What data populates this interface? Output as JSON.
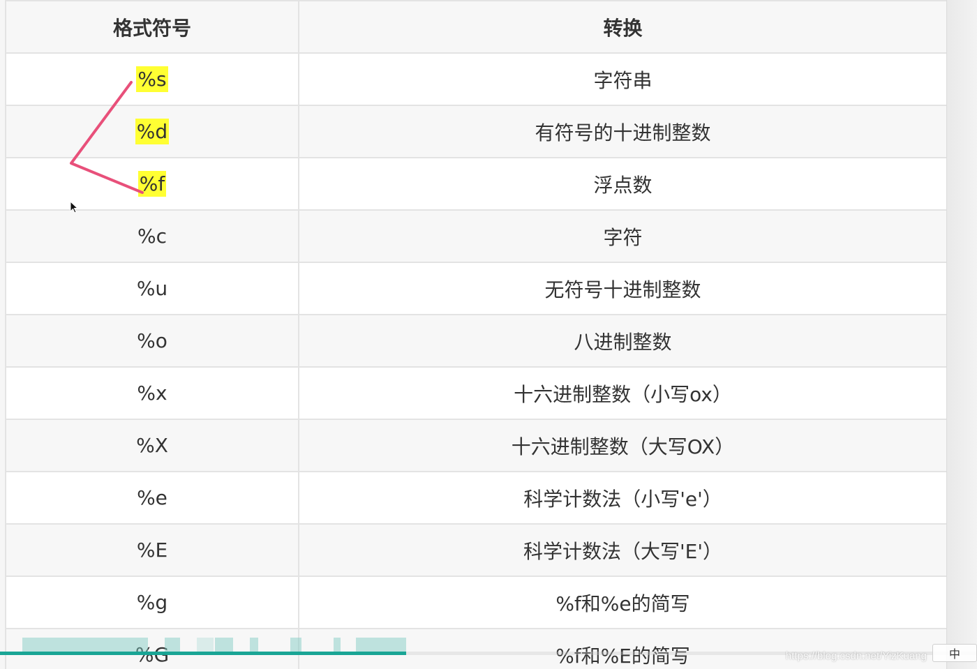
{
  "table": {
    "headers": [
      "格式符号",
      "转换"
    ],
    "rows": [
      {
        "symbol": "%s",
        "desc": "字符串"
      },
      {
        "symbol": "%d",
        "desc": "有符号的十进制整数"
      },
      {
        "symbol": "%f",
        "desc": "浮点数"
      },
      {
        "symbol": "%c",
        "desc": "字符"
      },
      {
        "symbol": "%u",
        "desc": "无符号十进制整数"
      },
      {
        "symbol": "%o",
        "desc": "八进制整数"
      },
      {
        "symbol": "%x",
        "desc": "十六进制整数（小写ox）"
      },
      {
        "symbol": "%X",
        "desc": "十六进制整数（大写OX）"
      },
      {
        "symbol": "%e",
        "desc": "科学计数法（小写'e'）"
      },
      {
        "symbol": "%E",
        "desc": "科学计数法（大写'E'）"
      },
      {
        "symbol": "%g",
        "desc": "%f和%e的简写"
      },
      {
        "symbol": "%G",
        "desc": "%f和%E的简写"
      }
    ]
  },
  "player": {
    "progress_fraction": 0.416,
    "watermark": "https://blog.csdn.net/YizKuang",
    "badge": "中"
  },
  "colors": {
    "highlight": "#ffff33",
    "annotation": "#e8507a",
    "progress": "#1aa595"
  }
}
